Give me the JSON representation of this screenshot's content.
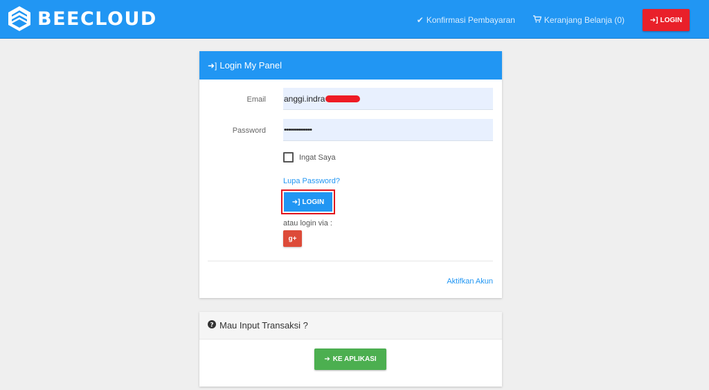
{
  "brand": {
    "name": "BEECLOUD"
  },
  "nav": {
    "confirm_payment": "Konfirmasi Pembayaran",
    "cart": "Keranjang Belanja (0)",
    "login": "LOGIN"
  },
  "login_panel": {
    "title": "Login My Panel",
    "email_label": "Email",
    "email_value": "anggi.indra",
    "password_label": "Password",
    "password_value": "••••••••••••••",
    "remember_label": "Ingat Saya",
    "remember_checked": false,
    "forgot_password": "Lupa Password?",
    "login_button": "LOGIN",
    "login_via": "atau login via :",
    "gplus": "g+",
    "activate_account": "Aktifkan Akun"
  },
  "transaction_panel": {
    "title": "Mau Input Transaksi ?",
    "app_button": "KE APLIKASI"
  },
  "icons": {
    "brand": "hexagon-logo-icon",
    "confirm": "check-icon",
    "cart": "cart-icon",
    "login": "sign-in-icon",
    "question": "question-circle-icon",
    "arrow": "arrow-right-icon"
  },
  "colors": {
    "primary": "#2196f3",
    "danger": "#e9202a",
    "success": "#4caf50",
    "gplus": "#dd4b39",
    "background": "#efefef"
  }
}
